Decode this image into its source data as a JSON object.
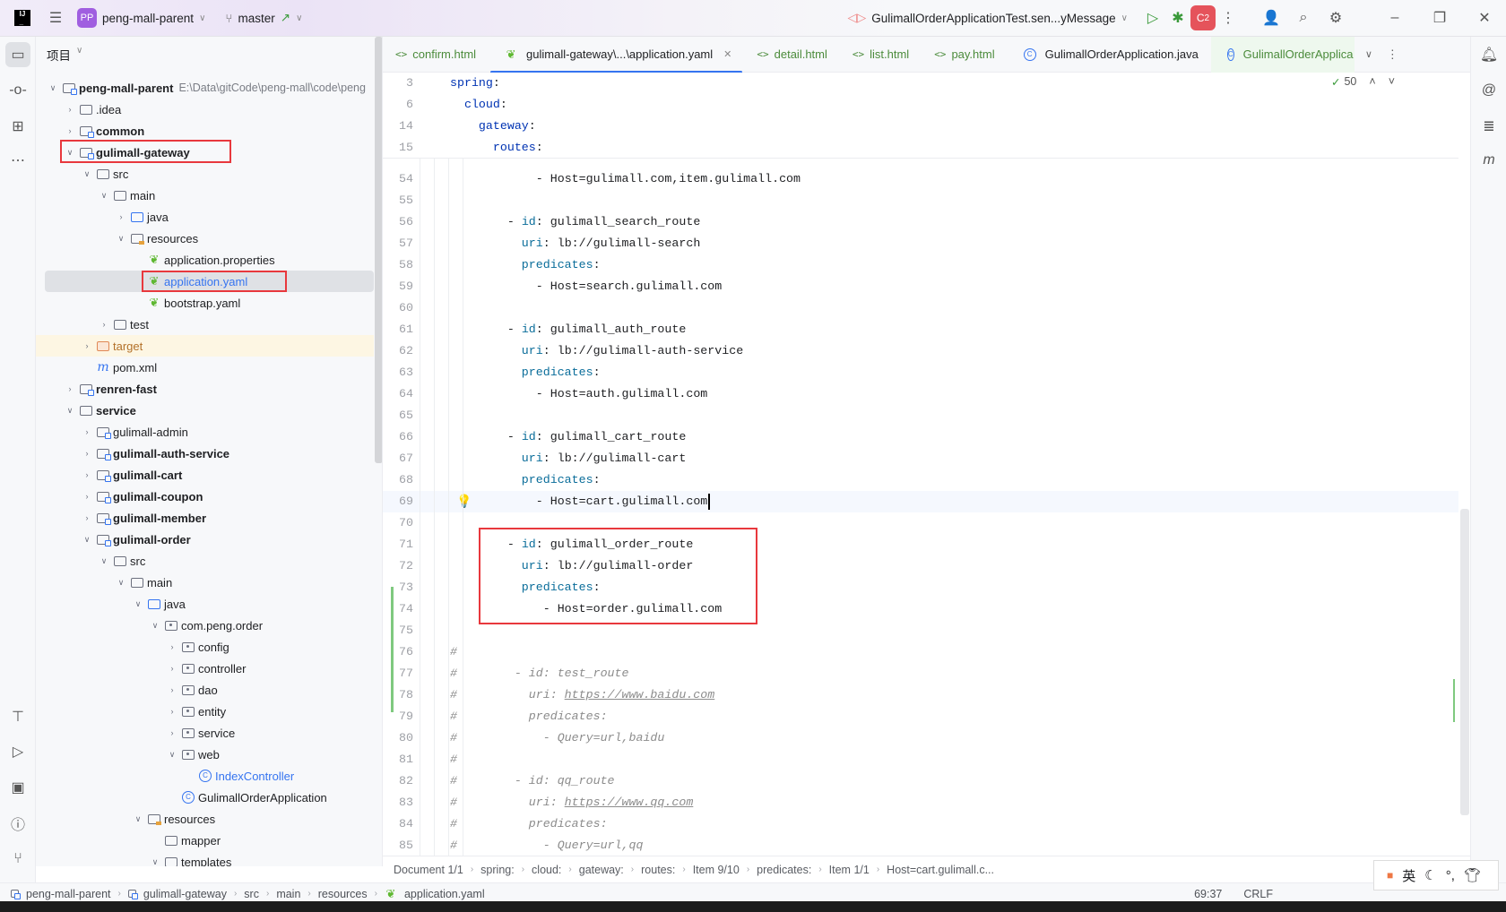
{
  "titlebar": {
    "project_badge": "PP",
    "project": "peng-mall-parent",
    "branch": "master",
    "run_config": "GulimallOrderApplicationTest.sen...yMessage",
    "c2_badge": "2"
  },
  "project_panel": {
    "title": "项目",
    "tree": [
      {
        "l": 0,
        "st": "open",
        "icon": "mod",
        "bold": true,
        "label": "peng-mall-parent",
        "extra": "E:\\Data\\gitCode\\peng-mall\\code\\peng"
      },
      {
        "l": 1,
        "st": "closed",
        "icon": "folder",
        "label": ".idea"
      },
      {
        "l": 1,
        "st": "closed",
        "icon": "mod",
        "bold": true,
        "label": "common"
      },
      {
        "l": 1,
        "st": "open",
        "icon": "mod",
        "bold": true,
        "label": "gulimall-gateway"
      },
      {
        "l": 2,
        "st": "open",
        "icon": "folder",
        "label": "src"
      },
      {
        "l": 3,
        "st": "open",
        "icon": "folder",
        "label": "main"
      },
      {
        "l": 4,
        "st": "closed",
        "icon": "blue",
        "label": "java"
      },
      {
        "l": 4,
        "st": "open",
        "icon": "res",
        "label": "resources"
      },
      {
        "l": 5,
        "icon": "spring",
        "label": "application.properties"
      },
      {
        "l": 5,
        "icon": "spring",
        "label": "application.yaml",
        "selected": true,
        "color": "#3574f0"
      },
      {
        "l": 5,
        "icon": "spring",
        "label": "bootstrap.yaml"
      },
      {
        "l": 3,
        "st": "closed",
        "icon": "folder",
        "label": "test"
      },
      {
        "l": 2,
        "st": "closed",
        "icon": "orange",
        "label": "target",
        "target": true,
        "color": "#b3712a"
      },
      {
        "l": 2,
        "icon": "mvn",
        "label": "pom.xml"
      },
      {
        "l": 1,
        "st": "closed",
        "icon": "mod",
        "bold": true,
        "label": "renren-fast"
      },
      {
        "l": 1,
        "st": "open",
        "icon": "folder",
        "bold": true,
        "label": "service"
      },
      {
        "l": 2,
        "st": "closed",
        "icon": "mod",
        "label": "gulimall-admin"
      },
      {
        "l": 2,
        "st": "closed",
        "icon": "mod",
        "bold": true,
        "label": "gulimall-auth-service"
      },
      {
        "l": 2,
        "st": "closed",
        "icon": "mod",
        "bold": true,
        "label": "gulimall-cart"
      },
      {
        "l": 2,
        "st": "closed",
        "icon": "mod",
        "bold": true,
        "label": "gulimall-coupon"
      },
      {
        "l": 2,
        "st": "closed",
        "icon": "mod",
        "bold": true,
        "label": "gulimall-member"
      },
      {
        "l": 2,
        "st": "open",
        "icon": "mod",
        "bold": true,
        "label": "gulimall-order"
      },
      {
        "l": 3,
        "st": "open",
        "icon": "folder",
        "label": "src"
      },
      {
        "l": 4,
        "st": "open",
        "icon": "folder",
        "label": "main"
      },
      {
        "l": 5,
        "st": "open",
        "icon": "blue",
        "label": "java"
      },
      {
        "l": 6,
        "st": "open",
        "icon": "pkg",
        "label": "com.peng.order"
      },
      {
        "l": 7,
        "st": "closed",
        "icon": "pkg",
        "label": "config"
      },
      {
        "l": 7,
        "st": "closed",
        "icon": "pkg",
        "label": "controller"
      },
      {
        "l": 7,
        "st": "closed",
        "icon": "pkg",
        "label": "dao"
      },
      {
        "l": 7,
        "st": "closed",
        "icon": "pkg",
        "label": "entity"
      },
      {
        "l": 7,
        "st": "closed",
        "icon": "pkg",
        "label": "service"
      },
      {
        "l": 7,
        "st": "open",
        "icon": "pkg",
        "label": "web"
      },
      {
        "l": 8,
        "icon": "cls",
        "label": "IndexController",
        "color": "#3574f0"
      },
      {
        "l": 7,
        "icon": "cls",
        "label": "GulimallOrderApplication"
      },
      {
        "l": 5,
        "st": "open",
        "icon": "res",
        "label": "resources"
      },
      {
        "l": 6,
        "icon": "folder",
        "label": "mapper"
      },
      {
        "l": 6,
        "st": "open",
        "icon": "folder",
        "label": "templates"
      }
    ]
  },
  "tabs": [
    {
      "label": "confirm.html",
      "icon": "html"
    },
    {
      "label": "gulimall-gateway\\...\\application.yaml",
      "icon": "spring",
      "active": true
    },
    {
      "label": "detail.html",
      "icon": "html"
    },
    {
      "label": "list.html",
      "icon": "html"
    },
    {
      "label": "pay.html",
      "icon": "html"
    },
    {
      "label": "GulimallOrderApplication.java",
      "icon": "class"
    },
    {
      "label": "GulimallOrderApplica",
      "icon": "class",
      "green": true
    }
  ],
  "editor": {
    "inspection_count": "50",
    "sticky": [
      {
        "n": "3",
        "i": 0,
        "t": "spring:"
      },
      {
        "n": "6",
        "i": 2,
        "t": "cloud:"
      },
      {
        "n": "14",
        "i": 4,
        "t": "gateway:"
      },
      {
        "n": "15",
        "i": 6,
        "t": "routes:"
      }
    ],
    "lines": [
      {
        "n": "54",
        "i": 12,
        "t": "- Host=gulimall.com,item.gulimall.com"
      },
      {
        "n": "55",
        "i": 0,
        "t": ""
      },
      {
        "n": "56",
        "i": 8,
        "t": "- id: gulimall_search_route"
      },
      {
        "n": "57",
        "i": 10,
        "t": "uri: lb://gulimall-search"
      },
      {
        "n": "58",
        "i": 10,
        "t": "predicates:"
      },
      {
        "n": "59",
        "i": 12,
        "t": "- Host=search.gulimall.com"
      },
      {
        "n": "60",
        "i": 0,
        "t": ""
      },
      {
        "n": "61",
        "i": 8,
        "t": "- id: gulimall_auth_route"
      },
      {
        "n": "62",
        "i": 10,
        "t": "uri: lb://gulimall-auth-service"
      },
      {
        "n": "63",
        "i": 10,
        "t": "predicates:"
      },
      {
        "n": "64",
        "i": 12,
        "t": "- Host=auth.gulimall.com"
      },
      {
        "n": "65",
        "i": 0,
        "t": ""
      },
      {
        "n": "66",
        "i": 8,
        "t": "- id: gulimall_cart_route"
      },
      {
        "n": "67",
        "i": 10,
        "t": "uri: lb://gulimall-cart"
      },
      {
        "n": "68",
        "i": 10,
        "t": "predicates:"
      },
      {
        "n": "69",
        "i": 12,
        "t": "- Host=cart.gulimall.com",
        "current": true
      },
      {
        "n": "70",
        "i": 0,
        "t": ""
      },
      {
        "n": "71",
        "i": 8,
        "t": "- id: gulimall_order_route"
      },
      {
        "n": "72",
        "i": 10,
        "t": "uri: lb://gulimall-order"
      },
      {
        "n": "73",
        "i": 10,
        "t": "predicates:"
      },
      {
        "n": "74",
        "i": 13,
        "t": "- Host=order.gulimall.com"
      },
      {
        "n": "75",
        "i": 0,
        "t": ""
      },
      {
        "n": "76",
        "c": true,
        "t": "#"
      },
      {
        "n": "77",
        "c": true,
        "t": "#        - id: test_route"
      },
      {
        "n": "78",
        "c": true,
        "t": "#          uri: ",
        "url": "https://www.baidu.com"
      },
      {
        "n": "79",
        "c": true,
        "t": "#          predicates:"
      },
      {
        "n": "80",
        "c": true,
        "t": "#            - Query=url,baidu"
      },
      {
        "n": "81",
        "c": true,
        "t": "#"
      },
      {
        "n": "82",
        "c": true,
        "t": "#        - id: qq_route"
      },
      {
        "n": "83",
        "c": true,
        "t": "#          uri: ",
        "url": "https://www.qq.com"
      },
      {
        "n": "84",
        "c": true,
        "t": "#          predicates:"
      },
      {
        "n": "85",
        "c": true,
        "t": "#            - Query=url,qq"
      }
    ]
  },
  "code_breadcrumb": [
    "Document 1/1",
    "spring:",
    "cloud:",
    "gateway:",
    "routes:",
    "Item 9/10",
    "predicates:",
    "Item 1/1",
    "Host=cart.gulimall.c..."
  ],
  "status": {
    "path": [
      "peng-mall-parent",
      "gulimall-gateway",
      "src",
      "main",
      "resources",
      "application.yaml"
    ],
    "position": "69:37",
    "line_sep": "CRLF"
  },
  "ime": {
    "lang": "英"
  }
}
